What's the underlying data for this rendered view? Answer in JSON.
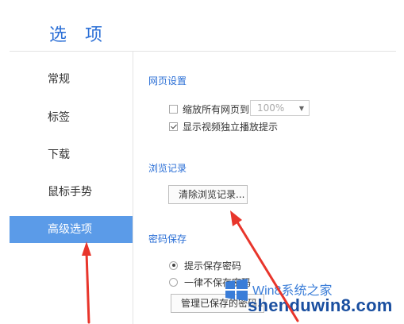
{
  "dialog": {
    "title": "选 项"
  },
  "sidebar": {
    "items": [
      {
        "label": "常规"
      },
      {
        "label": "标签"
      },
      {
        "label": "下载"
      },
      {
        "label": "鼠标手势"
      },
      {
        "label": "高级选项",
        "active": true
      }
    ]
  },
  "webpage_settings": {
    "title": "网页设置",
    "zoom_all": {
      "label": "缩放所有网页到",
      "checked": false,
      "select_value": "100%"
    },
    "show_video_tip": {
      "label": "显示视频独立播放提示",
      "checked": true
    }
  },
  "history": {
    "title": "浏览记录",
    "clear_button": "清除浏览记录..."
  },
  "password": {
    "title": "密码保存",
    "options": [
      {
        "label": "提示保存密码",
        "selected": true
      },
      {
        "label": "一律不保存密码",
        "selected": false
      }
    ],
    "manage_button": "管理已保存的密码..."
  },
  "watermark": {
    "line1": "Win8系统之家",
    "line2": "shenduwin8.com"
  },
  "colors": {
    "accent": "#2b6fd6",
    "active_nav": "#5b9be8",
    "arrow": "#e8352b"
  }
}
